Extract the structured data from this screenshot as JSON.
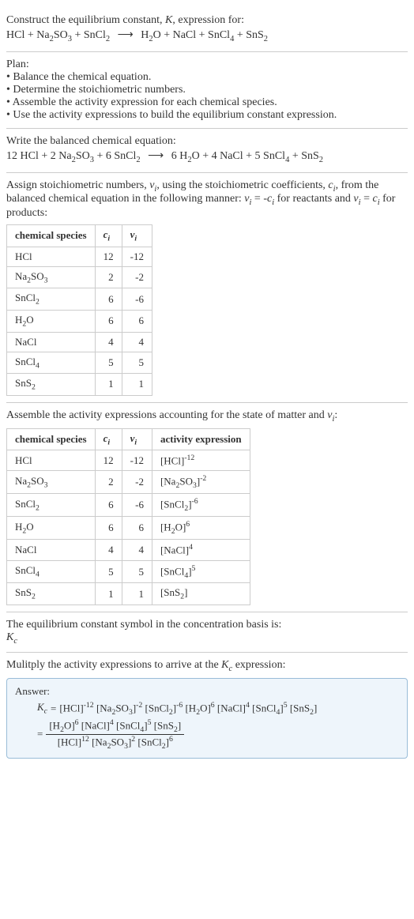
{
  "intro": {
    "line1_a": "Construct the equilibrium constant, ",
    "line1_k": "K",
    "line1_b": ", expression for:"
  },
  "eq_unbalanced": {
    "lhs": [
      {
        "t": "HCl"
      },
      {
        "t": "Na",
        "sub": "2",
        "tail": "SO",
        "sub2": "3"
      },
      {
        "t": "SnCl",
        "sub": "2"
      }
    ],
    "rhs": [
      {
        "t": "H",
        "sub": "2",
        "tail": "O"
      },
      {
        "t": "NaCl"
      },
      {
        "t": "SnCl",
        "sub": "4"
      },
      {
        "t": "SnS",
        "sub": "2"
      }
    ]
  },
  "plan": {
    "heading": "Plan:",
    "items": [
      "Balance the chemical equation.",
      "Determine the stoichiometric numbers.",
      "Assemble the activity expression for each chemical species.",
      "Use the activity expressions to build the equilibrium constant expression."
    ]
  },
  "balanced": {
    "heading": "Write the balanced chemical equation:",
    "lhs": [
      {
        "coef": "12",
        "t": "HCl"
      },
      {
        "coef": "2",
        "t": "Na",
        "sub": "2",
        "tail": "SO",
        "sub2": "3"
      },
      {
        "coef": "6",
        "t": "SnCl",
        "sub": "2"
      }
    ],
    "rhs": [
      {
        "coef": "6",
        "t": "H",
        "sub": "2",
        "tail": "O"
      },
      {
        "coef": "4",
        "t": "NaCl"
      },
      {
        "coef": "5",
        "t": "SnCl",
        "sub": "4"
      },
      {
        "coef": "",
        "t": "SnS",
        "sub": "2"
      }
    ]
  },
  "assign_text": {
    "a": "Assign stoichiometric numbers, ",
    "nu": "ν",
    "i": "i",
    "b": ", using the stoichiometric coefficients, ",
    "c": "c",
    "d": ", from the balanced chemical equation in the following manner: ",
    "eq1a": " = -",
    "eq1b": " for reactants and ",
    "eq2a": " = ",
    "eq2b": " for products:"
  },
  "table1": {
    "headers": [
      "chemical species",
      "cᵢ",
      "νᵢ"
    ],
    "rows": [
      {
        "sp": {
          "t": "HCl"
        },
        "c": "12",
        "v": "-12"
      },
      {
        "sp": {
          "t": "Na",
          "sub": "2",
          "tail": "SO",
          "sub2": "3"
        },
        "c": "2",
        "v": "-2"
      },
      {
        "sp": {
          "t": "SnCl",
          "sub": "2"
        },
        "c": "6",
        "v": "-6"
      },
      {
        "sp": {
          "t": "H",
          "sub": "2",
          "tail": "O"
        },
        "c": "6",
        "v": "6"
      },
      {
        "sp": {
          "t": "NaCl"
        },
        "c": "4",
        "v": "4"
      },
      {
        "sp": {
          "t": "SnCl",
          "sub": "4"
        },
        "c": "5",
        "v": "5"
      },
      {
        "sp": {
          "t": "SnS",
          "sub": "2"
        },
        "c": "1",
        "v": "1"
      }
    ]
  },
  "assemble_text": {
    "a": "Assemble the activity expressions accounting for the state of matter and ",
    "b": ":"
  },
  "table2": {
    "headers": [
      "chemical species",
      "cᵢ",
      "νᵢ",
      "activity expression"
    ],
    "rows": [
      {
        "sp": {
          "t": "HCl"
        },
        "c": "12",
        "v": "-12",
        "act": {
          "t": "HCl",
          "exp": "-12"
        }
      },
      {
        "sp": {
          "t": "Na",
          "sub": "2",
          "tail": "SO",
          "sub2": "3"
        },
        "c": "2",
        "v": "-2",
        "act": {
          "t": "Na",
          "sub": "2",
          "tail": "SO",
          "sub2": "3",
          "exp": "-2"
        }
      },
      {
        "sp": {
          "t": "SnCl",
          "sub": "2"
        },
        "c": "6",
        "v": "-6",
        "act": {
          "t": "SnCl",
          "sub": "2",
          "exp": "-6"
        }
      },
      {
        "sp": {
          "t": "H",
          "sub": "2",
          "tail": "O"
        },
        "c": "6",
        "v": "6",
        "act": {
          "t": "H",
          "sub": "2",
          "tail": "O",
          "exp": "6"
        }
      },
      {
        "sp": {
          "t": "NaCl"
        },
        "c": "4",
        "v": "4",
        "act": {
          "t": "NaCl",
          "exp": "4"
        }
      },
      {
        "sp": {
          "t": "SnCl",
          "sub": "4"
        },
        "c": "5",
        "v": "5",
        "act": {
          "t": "SnCl",
          "sub": "4",
          "exp": "5"
        }
      },
      {
        "sp": {
          "t": "SnS",
          "sub": "2"
        },
        "c": "1",
        "v": "1",
        "act": {
          "t": "SnS",
          "sub": "2",
          "exp": ""
        }
      }
    ]
  },
  "eq_symbol": {
    "line1": "The equilibrium constant symbol in the concentration basis is:",
    "k": "K",
    "sub": "c"
  },
  "multiply": {
    "a": "Mulitply the activity expressions to arrive at the ",
    "k": "K",
    "sub": "c",
    "b": " expression:"
  },
  "answer": {
    "label": "Answer:",
    "k": "K",
    "ksub": "c",
    "eq": " = ",
    "terms": [
      {
        "t": "HCl",
        "exp": "-12"
      },
      {
        "t": "Na",
        "sub": "2",
        "tail": "SO",
        "sub2": "3",
        "exp": "-2"
      },
      {
        "t": "SnCl",
        "sub": "2",
        "exp": "-6"
      },
      {
        "t": "H",
        "sub": "2",
        "tail": "O",
        "exp": "6"
      },
      {
        "t": "NaCl",
        "exp": "4"
      },
      {
        "t": "SnCl",
        "sub": "4",
        "exp": "5"
      },
      {
        "t": "SnS",
        "sub": "2",
        "exp": ""
      }
    ],
    "frac": {
      "num": [
        {
          "t": "H",
          "sub": "2",
          "tail": "O",
          "exp": "6"
        },
        {
          "t": "NaCl",
          "exp": "4"
        },
        {
          "t": "SnCl",
          "sub": "4",
          "exp": "5"
        },
        {
          "t": "SnS",
          "sub": "2",
          "exp": ""
        }
      ],
      "den": [
        {
          "t": "HCl",
          "exp": "12"
        },
        {
          "t": "Na",
          "sub": "2",
          "tail": "SO",
          "sub2": "3",
          "exp": "2"
        },
        {
          "t": "SnCl",
          "sub": "2",
          "exp": "6"
        }
      ]
    }
  },
  "glyphs": {
    "plus": " + ",
    "arrow": "⟶",
    "eq": " = "
  }
}
